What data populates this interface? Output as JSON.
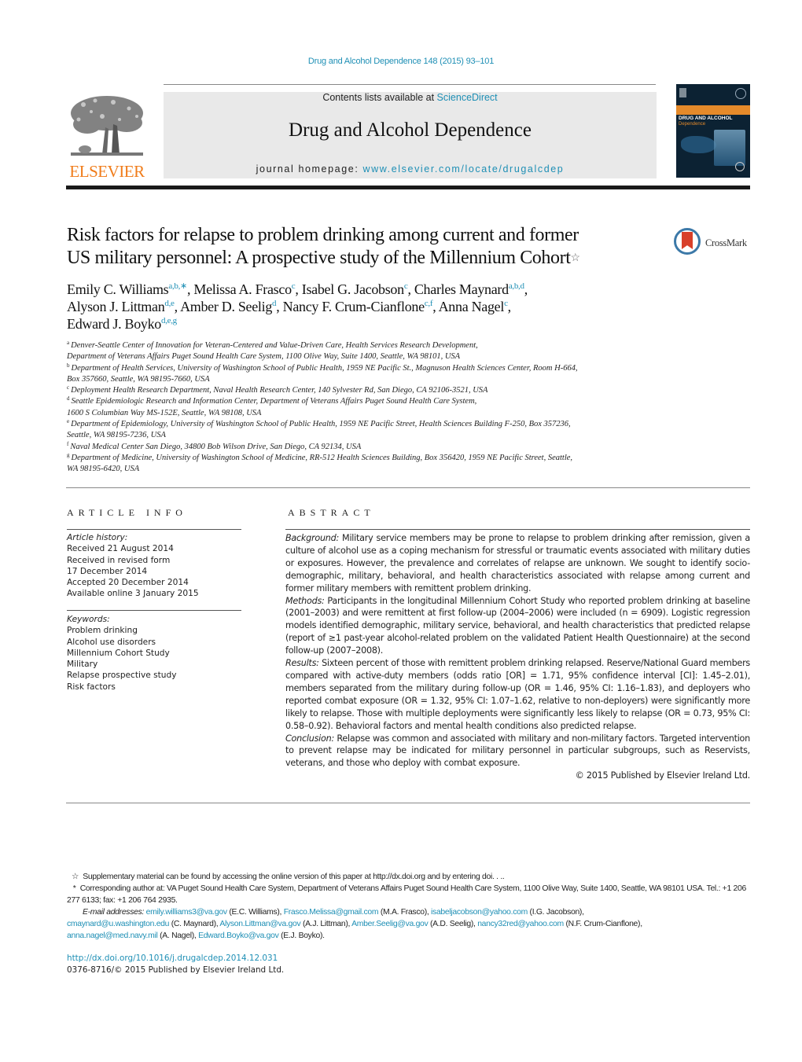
{
  "header": {
    "citation": "Drug and Alcohol Dependence 148 (2015) 93–101",
    "contents_prefix": "Contents lists available at ",
    "contents_link": "ScienceDirect",
    "journal_title": "Drug and Alcohol Dependence",
    "homepage_prefix": "journal homepage: ",
    "homepage_link": "www.elsevier.com/locate/drugalcdep",
    "publisher_logo_text": "ELSEVIER",
    "cover_title": "DRUG AND ALCOHOL",
    "cover_subtitle": "Dependence",
    "brand_color": "#f07c1a",
    "link_color": "#1e8fb5"
  },
  "article": {
    "title_line1": "Risk factors for relapse to problem drinking among current and former",
    "title_line2": "US military personnel: A prospective study of the Millennium Cohort",
    "title_mark": "☆",
    "crossmark_label": "CrossMark",
    "authors": [
      {
        "name": "Emily C. Williams",
        "sup": "a,b,∗",
        "sep": ", "
      },
      {
        "name": "Melissa A. Frasco",
        "sup": "c",
        "sep": ", "
      },
      {
        "name": "Isabel G. Jacobson",
        "sup": "c",
        "sep": ", "
      },
      {
        "name": "Charles Maynard",
        "sup": "a,b,d",
        "sep": ","
      },
      {
        "name": "Alyson J. Littman",
        "sup": "d,e",
        "sep": ", "
      },
      {
        "name": "Amber D. Seelig",
        "sup": "d",
        "sep": ", "
      },
      {
        "name": "Nancy F. Crum-Cianflone",
        "sup": "c,f",
        "sep": ", "
      },
      {
        "name": "Anna Nagel",
        "sup": "c",
        "sep": ","
      },
      {
        "name": "Edward J. Boyko",
        "sup": "d,e,g",
        "sep": ""
      }
    ],
    "affiliations": [
      {
        "key": "a",
        "lines": [
          "Denver-Seattle Center of Innovation for Veteran-Centered and Value-Driven Care, Health Services Research Development,",
          "Department of Veterans Affairs Puget Sound Health Care System, 1100 Olive Way, Suite 1400, Seattle, WA 98101, USA"
        ]
      },
      {
        "key": "b",
        "lines": [
          "Department of Health Services, University of Washington School of Public Health, 1959 NE Pacific St., Magnuson Health Sciences Center, Room H-664,",
          "Box 357660, Seattle, WA 98195-7660, USA"
        ]
      },
      {
        "key": "c",
        "lines": [
          "Deployment Health Research Department, Naval Health Research Center, 140 Sylvester Rd, San Diego, CA 92106-3521, USA"
        ]
      },
      {
        "key": "d",
        "lines": [
          "Seattle Epidemiologic Research and Information Center, Department of Veterans Affairs Puget Sound Health Care System,",
          "1600 S Columbian Way MS-152E, Seattle, WA 98108, USA"
        ]
      },
      {
        "key": "e",
        "lines": [
          "Department of Epidemiology, University of Washington School of Public Health, 1959 NE Pacific Street, Health Sciences Building F-250, Box 357236,",
          "Seattle, WA 98195-7236, USA"
        ]
      },
      {
        "key": "f",
        "lines": [
          "Naval Medical Center San Diego, 34800 Bob Wilson Drive, San Diego, CA 92134, USA"
        ]
      },
      {
        "key": "g",
        "lines": [
          "Department of Medicine, University of Washington School of Medicine, RR-512 Health Sciences Building, Box 356420, 1959 NE Pacific Street, Seattle,",
          "WA 98195-6420, USA"
        ]
      }
    ]
  },
  "article_info": {
    "heading": "ARTICLE INFO",
    "history_label": "Article history:",
    "history": [
      "Received 21 August 2014",
      "Received in revised form",
      "17 December 2014",
      "Accepted 20 December 2014",
      "Available online 3 January 2015"
    ],
    "keywords_label": "Keywords:",
    "keywords": [
      "Problem drinking",
      "Alcohol use disorders",
      "Millennium Cohort Study",
      "Military",
      "Relapse prospective study",
      "Risk factors"
    ]
  },
  "abstract": {
    "heading": "ABSTRACT",
    "sections": [
      {
        "label": "Background:",
        "text": " Military service members may be prone to relapse to problem drinking after remission, given a culture of alcohol use as a coping mechanism for stressful or traumatic events associated with military duties or exposures. However, the prevalence and correlates of relapse are unknown. We sought to identify socio-demographic, military, behavioral, and health characteristics associated with relapse among current and former military members with remittent problem drinking."
      },
      {
        "label": "Methods:",
        "text": " Participants in the longitudinal Millennium Cohort Study who reported problem drinking at baseline (2001–2003) and were remittent at first follow-up (2004–2006) were included (n = 6909). Logistic regression models identified demographic, military service, behavioral, and health characteristics that predicted relapse (report of ≥1 past-year alcohol-related problem on the validated Patient Health Questionnaire) at the second follow-up (2007–2008)."
      },
      {
        "label": "Results:",
        "text": " Sixteen percent of those with remittent problem drinking relapsed. Reserve/National Guard members compared with active-duty members (odds ratio [OR] = 1.71, 95% confidence interval [CI]: 1.45–2.01), members separated from the military during follow-up (OR = 1.46, 95% CI: 1.16–1.83), and deployers who reported combat exposure (OR = 1.32, 95% CI: 1.07–1.62, relative to non-deployers) were significantly more likely to relapse. Those with multiple deployments were significantly less likely to relapse (OR = 0.73, 95% CI: 0.58–0.92). Behavioral factors and mental health conditions also predicted relapse."
      },
      {
        "label": "Conclusion:",
        "text": " Relapse was common and associated with military and non-military factors. Targeted intervention to prevent relapse may be indicated for military personnel in particular subgroups, such as Reservists, veterans, and those who deploy with combat exposure."
      }
    ],
    "copyright": "© 2015 Published by Elsevier Ireland Ltd."
  },
  "footnotes": {
    "star_mark": "☆",
    "star_text": "Supplementary material can be found by accessing the online version of this paper at http://dx.doi.org and by entering doi. . ..",
    "corr_mark": "*",
    "corr_text": "Corresponding author at: VA Puget Sound Health Care System, Department of Veterans Affairs Puget Sound Health Care System, 1100 Olive Way, Suite 1400, Seattle, WA 98101 USA. Tel.: +1 206 277 6133; fax: +1 206 764 2935.",
    "email_label": "E-mail addresses:",
    "emails": [
      {
        "email": "emily.williams3@va.gov",
        "who": " (E.C. Williams), "
      },
      {
        "email": "Frasco.Melissa@gmail.com",
        "who": " (M.A. Frasco), "
      },
      {
        "email": "isabeljacobson@yahoo.com",
        "who": " (I.G. Jacobson), "
      },
      {
        "email": "cmaynard@u.washington.edu",
        "who": " (C. Maynard), "
      },
      {
        "email": "Alyson.Littman@va.gov",
        "who": " (A.J. Littman), "
      },
      {
        "email": "Amber.Seelig@va.gov",
        "who": " (A.D. Seelig), "
      },
      {
        "email": "nancy32red@yahoo.com",
        "who": " (N.F. Crum-Cianflone), "
      },
      {
        "email": "anna.nagel@med.navy.mil",
        "who": " (A. Nagel), "
      },
      {
        "email": "Edward.Boyko@va.gov",
        "who": " (E.J. Boyko)."
      }
    ],
    "doi_link": "http://dx.doi.org/10.1016/j.drugalcdep.2014.12.031",
    "issn_line": "0376-8716/© 2015 Published by Elsevier Ireland Ltd."
  }
}
